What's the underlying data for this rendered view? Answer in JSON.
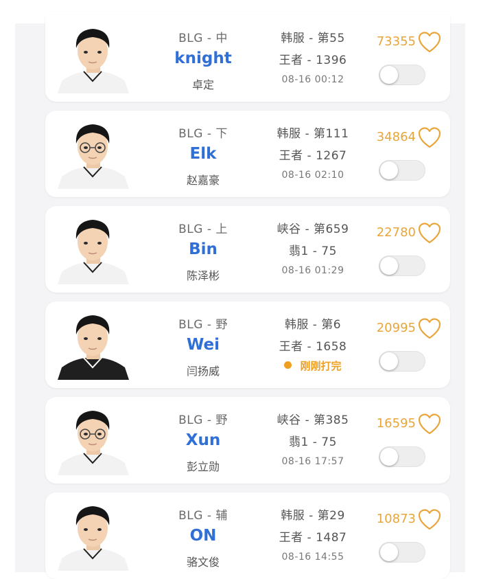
{
  "players": [
    {
      "team_pos": "BLG - 中",
      "id": "knight",
      "name": "卓定",
      "server_rank": "韩服 - 第55",
      "tier_lp": "王者 - 1396",
      "time": "08-16 00:12",
      "likes": "73355",
      "live": false,
      "shirt": "#f2f2f2"
    },
    {
      "team_pos": "BLG - 下",
      "id": "Elk",
      "name": "赵嘉豪",
      "server_rank": "韩服 - 第111",
      "tier_lp": "王者 - 1267",
      "time": "08-16 02:10",
      "likes": "34864",
      "live": false,
      "shirt": "#f2f2f2"
    },
    {
      "team_pos": "BLG - 上",
      "id": "Bin",
      "name": "陈泽彬",
      "server_rank": "峡谷 - 第659",
      "tier_lp": "翡1 - 75",
      "time": "08-16 01:29",
      "likes": "22780",
      "live": false,
      "shirt": "#f2f2f2"
    },
    {
      "team_pos": "BLG - 野",
      "id": "Wei",
      "name": "闫扬威",
      "server_rank": "韩服 - 第6",
      "tier_lp": "王者 - 1658",
      "time": "",
      "live_text": "刚刚打完",
      "likes": "20995",
      "live": true,
      "shirt": "#1f1f1f"
    },
    {
      "team_pos": "BLG - 野",
      "id": "Xun",
      "name": "彭立勋",
      "server_rank": "峡谷 - 第385",
      "tier_lp": "翡1 - 75",
      "time": "08-16 17:57",
      "likes": "16595",
      "live": false,
      "shirt": "#f2f2f2"
    },
    {
      "team_pos": "BLG - 辅",
      "id": "ON",
      "name": "骆文俊",
      "server_rank": "韩服 - 第29",
      "tier_lp": "王者 - 1487",
      "time": "08-16 14:55",
      "likes": "10873",
      "live": false,
      "shirt": "#f2f2f2"
    }
  ],
  "colors": {
    "id_blue": "#2f6fd6",
    "like_gold": "#e8a53a",
    "live_orange": "#f0a020"
  }
}
